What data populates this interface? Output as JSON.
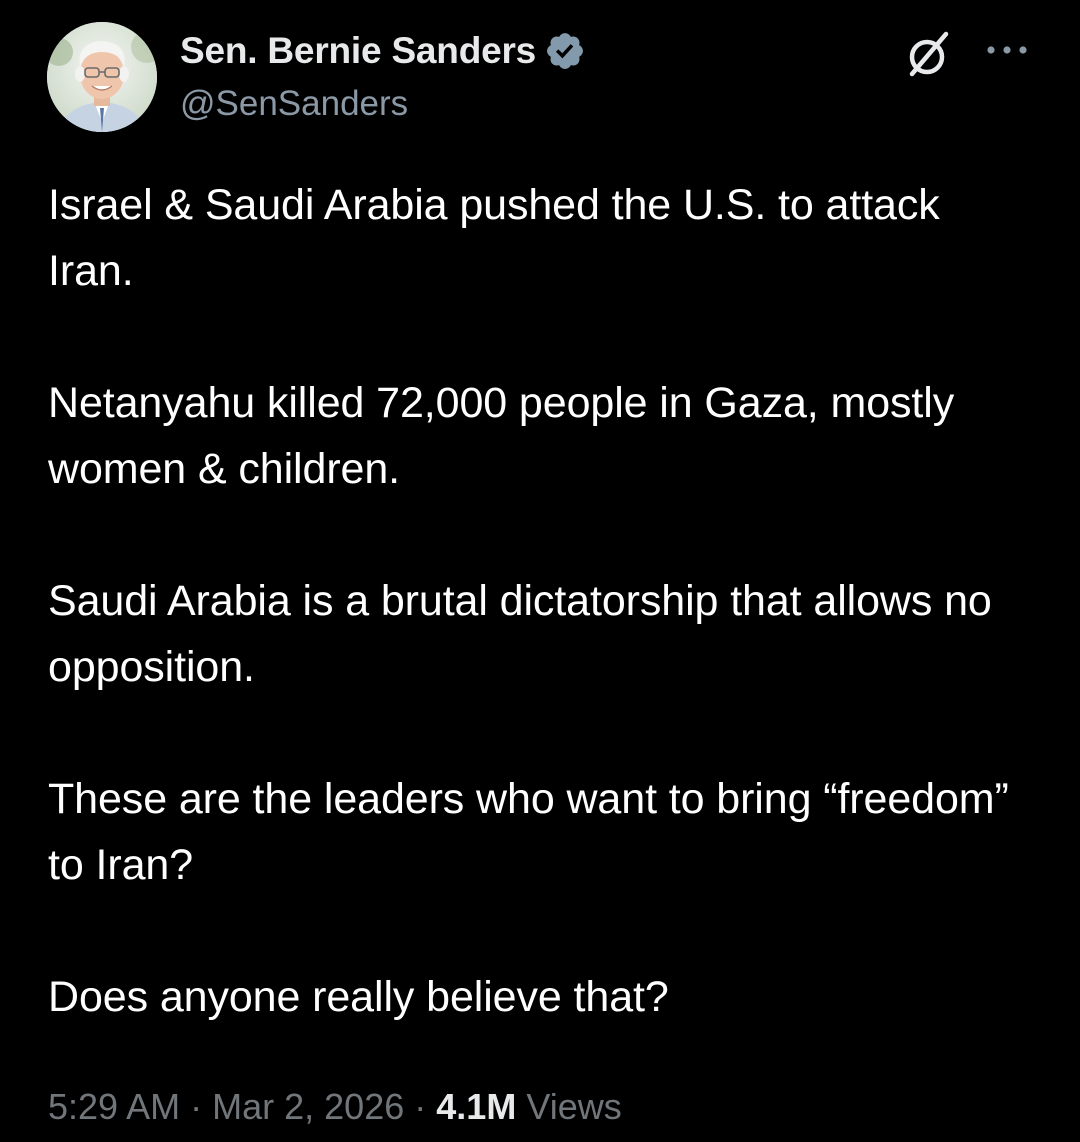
{
  "author": {
    "display_name": "Sen. Bernie Sanders",
    "handle": "@SenSanders",
    "verified": true,
    "badge_color": "#829aab"
  },
  "header_icons": {
    "grok": "grok-icon",
    "more": "more-options-icon"
  },
  "tweet": {
    "paragraphs": [
      "Israel & Saudi Arabia pushed the U.S. to attack Iran.",
      "Netanyahu killed 72,000 people in Gaza, mostly women & children.",
      "Saudi Arabia is a brutal dictatorship that allows no opposition.",
      "These are the leaders who want to bring “freedom” to Iran?",
      "Does anyone really believe that?"
    ]
  },
  "meta": {
    "time": "5:29 AM",
    "separator": "·",
    "date": "Mar 2, 2026",
    "views_count": "4.1M",
    "views_label": "Views"
  },
  "colors": {
    "background": "#000000",
    "text": "#ffffff",
    "secondary_text": "#71767b",
    "handle_text": "#8b98a5"
  }
}
